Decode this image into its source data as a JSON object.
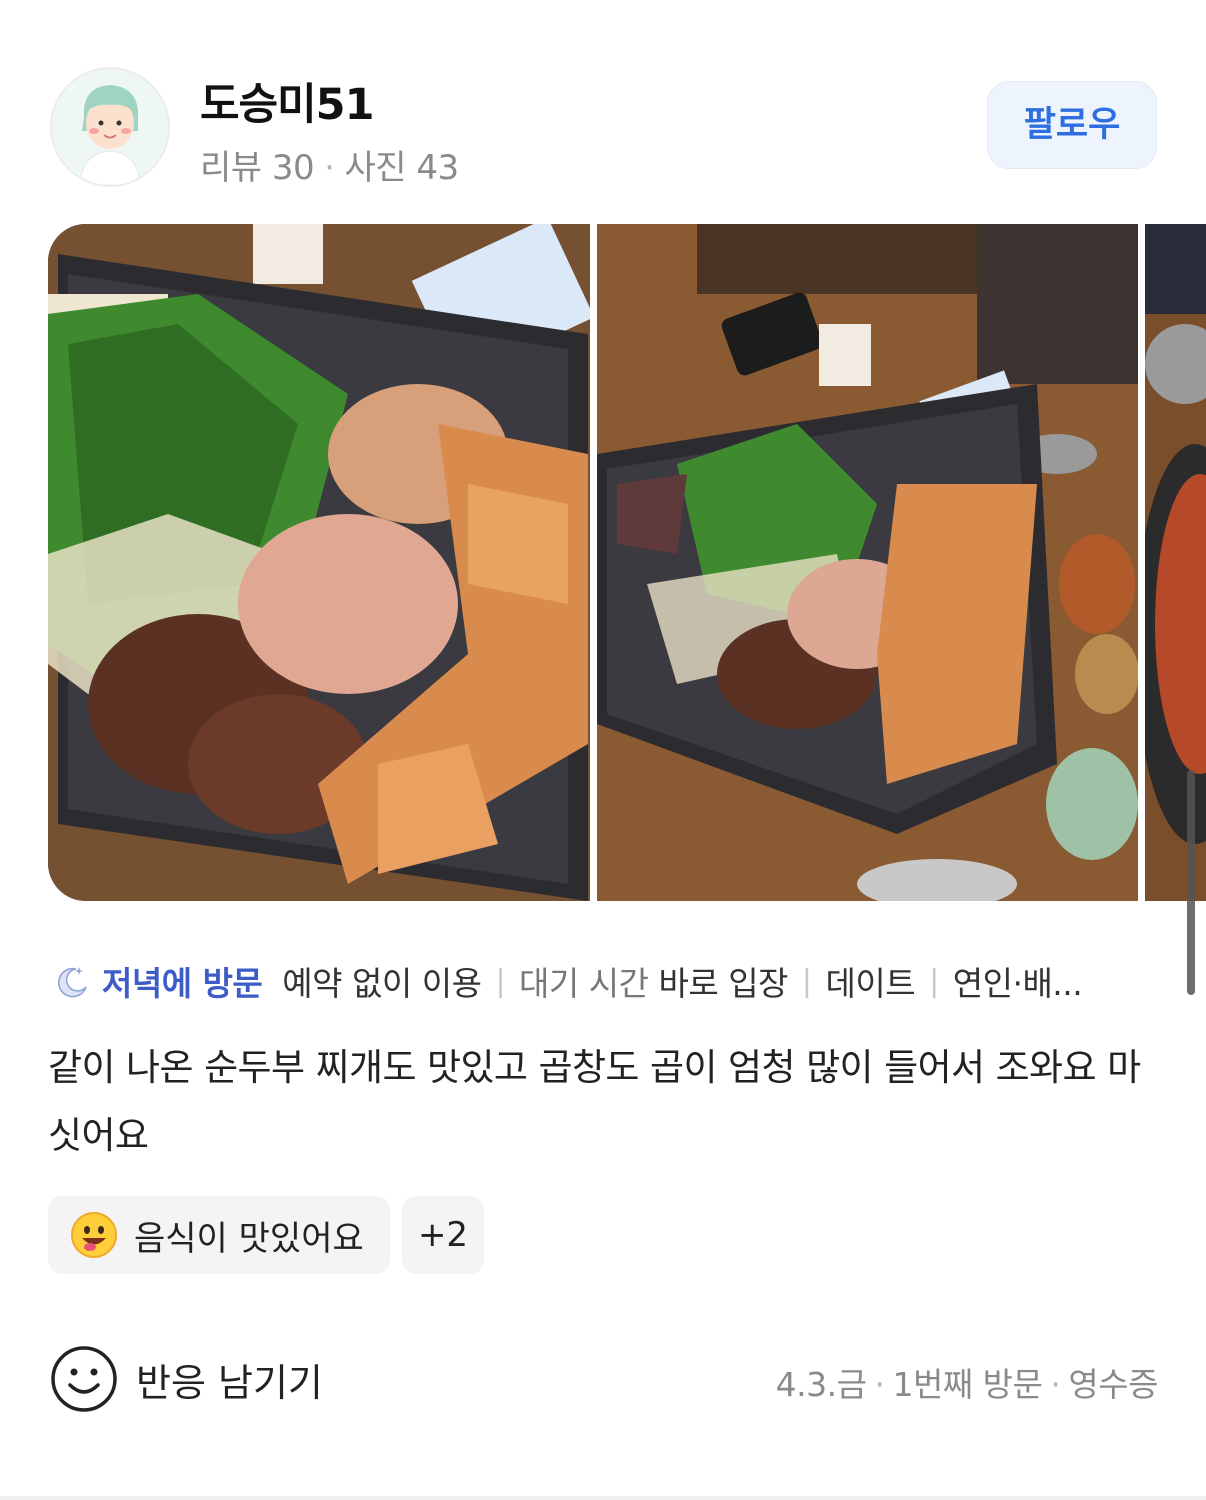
{
  "user": {
    "name": "도승미51",
    "reviews": "리뷰 30",
    "photos": "사진 43",
    "avatar_icon": "avatar-icon"
  },
  "follow_label": "팔로우",
  "photos": {
    "items": [
      {
        "alt_icon": "food-photo-icon"
      },
      {
        "alt_icon": "food-photo-icon"
      },
      {
        "alt_icon": "food-photo-icon"
      }
    ]
  },
  "visit_tags": {
    "icon": "moon-icon",
    "primary": "저녁에 방문",
    "items": [
      {
        "key": "",
        "value": "예약 없이 이용"
      },
      {
        "key": "대기 시간",
        "value": "바로 입장"
      },
      {
        "key": "",
        "value": "데이트"
      },
      {
        "key": "",
        "value": "연인·배..."
      }
    ]
  },
  "review_text": "같이 나온 순두부 찌개도 맛있고 곱창도 곱이 엄청 많이 들어서 조와요 마싯어요",
  "keyword_chip": {
    "icon": "smiley-emoji-icon",
    "label": "음식이 맛있어요"
  },
  "more_chip": "+2",
  "reaction_label": "반응 남기기",
  "meta": {
    "date": "4.3.금",
    "visit": "1번째 방문",
    "receipt": "영수증"
  },
  "colors": {
    "follow_text": "#2d6fe0",
    "follow_bg": "#eef4fd",
    "visit_primary": "#3c5cc8",
    "chip_bg": "#f4f4f4"
  }
}
